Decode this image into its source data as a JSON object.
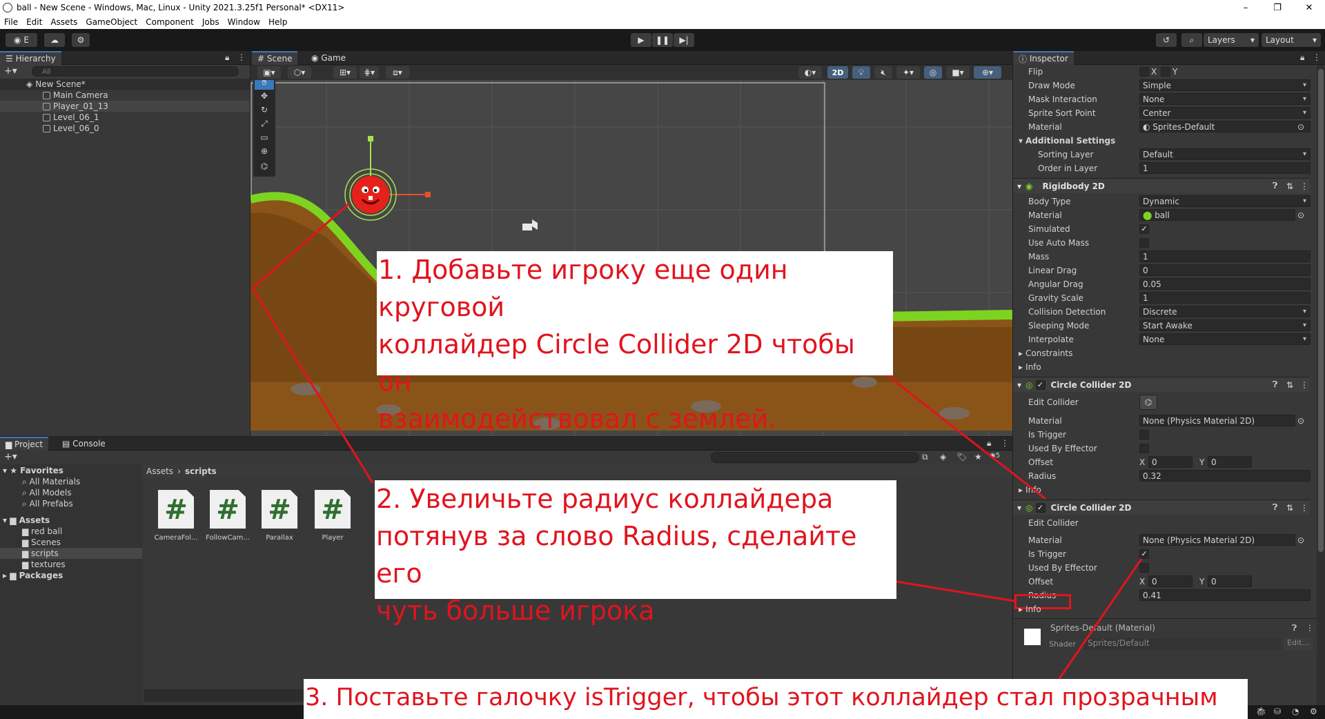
{
  "window": {
    "title": "ball - New Scene - Windows, Mac, Linux - Unity 2021.3.25f1 Personal* <DX11>",
    "minimize": "–",
    "maximize": "❐",
    "close": "✕"
  },
  "menu": [
    "File",
    "Edit",
    "Assets",
    "GameObject",
    "Component",
    "Jobs",
    "Window",
    "Help"
  ],
  "toolbar": {
    "account": "E",
    "layers": "Layers",
    "layout": "Layout"
  },
  "hierarchy": {
    "title": "Hierarchy",
    "search_placeholder": "All",
    "scene": "New Scene*",
    "items": [
      "Main Camera",
      "Player_01_13",
      "Level_06_1",
      "Level_06_0"
    ]
  },
  "scene_tabs": [
    "Scene",
    "Game"
  ],
  "scene_toolbar": {
    "mode2d": "2D"
  },
  "project": {
    "tabs": [
      "Project",
      "Console"
    ],
    "favorites_label": "Favorites",
    "favorites": [
      "All Materials",
      "All Models",
      "All Prefabs"
    ],
    "assets_label": "Assets",
    "assets": [
      "red ball",
      "Scenes",
      "scripts",
      "textures"
    ],
    "packages_label": "Packages",
    "breadcrumb": [
      "Assets",
      "scripts"
    ],
    "count": "5",
    "files": [
      "CameraFol...",
      "FollowCam...",
      "Parallax",
      "Player"
    ]
  },
  "inspector": {
    "title": "Inspector",
    "sprite": {
      "flip_label": "Flip",
      "flip_x": "X",
      "flip_y": "Y",
      "draw_mode_label": "Draw Mode",
      "draw_mode": "Simple",
      "mask_label": "Mask Interaction",
      "mask": "None",
      "sort_point_label": "Sprite Sort Point",
      "sort_point": "Center",
      "material_label": "Material",
      "material": "Sprites-Default",
      "additional": "Additional Settings",
      "sorting_layer_label": "Sorting Layer",
      "sorting_layer": "Default",
      "order_label": "Order in Layer",
      "order": "1"
    },
    "rigidbody": {
      "title": "Rigidbody 2D",
      "body_type_label": "Body Type",
      "body_type": "Dynamic",
      "material_label": "Material",
      "material": "ball",
      "simulated_label": "Simulated",
      "auto_mass_label": "Use Auto Mass",
      "mass_label": "Mass",
      "mass": "1",
      "linear_drag_label": "Linear Drag",
      "linear_drag": "0",
      "angular_drag_label": "Angular Drag",
      "angular_drag": "0.05",
      "gravity_label": "Gravity Scale",
      "gravity": "1",
      "collision_label": "Collision Detection",
      "collision": "Discrete",
      "sleeping_label": "Sleeping Mode",
      "sleeping": "Start Awake",
      "interpolate_label": "Interpolate",
      "interpolate": "None",
      "constraints": "Constraints",
      "info": "Info"
    },
    "collider1": {
      "title": "Circle Collider 2D",
      "edit_label": "Edit Collider",
      "material_label": "Material",
      "material": "None (Physics Material 2D)",
      "trigger_label": "Is Trigger",
      "effector_label": "Used By Effector",
      "offset_label": "Offset",
      "x": "X",
      "xv": "0",
      "y": "Y",
      "yv": "0",
      "radius_label": "Radius",
      "radius": "0.32",
      "info": "Info"
    },
    "collider2": {
      "title": "Circle Collider 2D",
      "edit_label": "Edit Collider",
      "material_label": "Material",
      "material": "None (Physics Material 2D)",
      "trigger_label": "Is Trigger",
      "effector_label": "Used By Effector",
      "offset_label": "Offset",
      "x": "X",
      "xv": "0",
      "y": "Y",
      "yv": "0",
      "radius_label": "Radius",
      "radius": "0.41",
      "info": "Info"
    },
    "matfooter": {
      "name": "Sprites-Default (Material)",
      "shader_label": "Shader",
      "shader": "Sprites/Default",
      "edit": "Edit..."
    }
  },
  "notes": {
    "n1": [
      "1. Добавьте игроку еще один круговой",
      "коллайдер Circle Collider 2D чтобы он",
      "взаимодействовал с землей."
    ],
    "n2": [
      "2. Увеличьте радиус коллайдера",
      "потянув за слово Radius, сделайте его",
      "чуть больше игрока"
    ],
    "n3": "3. Поставьте галочку isTrigger, чтобы этот коллайдер стал прозрачным"
  },
  "colors": {
    "annotation": "#e0141e",
    "accent": "#3a79bb",
    "ground": "#8a5418",
    "grass": "#7ed321"
  }
}
